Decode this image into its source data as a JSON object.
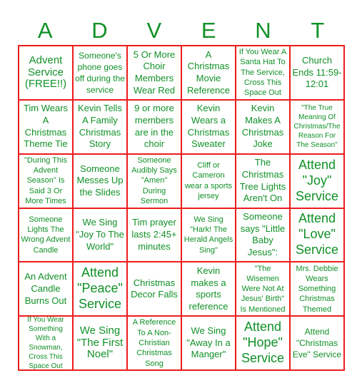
{
  "title_letters": [
    "A",
    "D",
    "V",
    "E",
    "N",
    "T"
  ],
  "colors": {
    "text": "#119127",
    "border": "#ee1c1c"
  },
  "cells": [
    [
      "Advent Service (FREE!!)",
      "Someone's phone goes off during the service",
      "5 Or More Choir Members Wear Red",
      "A Christmas Movie Reference",
      "If You Wear A Santa Hat To The Service, Cross This Space Out",
      "Church Ends 11:59-12:01"
    ],
    [
      "Tim Wears A Christmas Theme Tie",
      "Kevin Tells A Family Christmas Story",
      "9 or more members are in the choir",
      "Kevin Wears a Christmas Sweater",
      "Kevin Makes A Christmas Joke",
      "\"The True Meaning Of Christmas/The Reason For The Season\""
    ],
    [
      "\"During This Advent Season\" Is Said 3 Or More Times",
      "Someone Messes Up the Slides",
      "Someone Audibly Says \"Amen\" During Sermon",
      "Cliff or Cameron wear a sports jersey",
      "The Christmas Tree Lights Aren't On",
      "Attend \"Joy\" Service"
    ],
    [
      "Someone Lights The Wrong Advent Candle",
      "We Sing \"Joy To The World\"",
      "Tim prayer lasts 2:45+ minutes",
      "We Sing \"Hark! The Herald Angels Sing\"",
      "Someone says \"Little Baby Jesus\":",
      "Attend \"Love\" Service"
    ],
    [
      "An Advent Candle Burns Out",
      "Attend \"Peace\" Service",
      "Christmas Decor Falls",
      "Kevin makes a sports reference",
      "\"The Wisemen Were Not At Jesus' Birth\" Is Mentioned",
      "Mrs. Debbie Wears Something Christmas Themed"
    ],
    [
      "If You Wear Something With a Snowman, Cross This Space Out",
      "We Sing \"The First Noel\"",
      "A Reference To A Non-Christian Christmas Song",
      "We Sing \"Away In a Manger\"",
      "Attend \"Hope\" Service",
      "Attend \"Christmas Eve\" Service"
    ]
  ]
}
